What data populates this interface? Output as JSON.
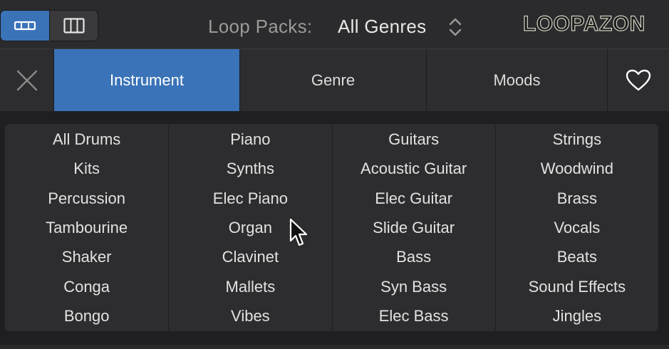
{
  "header": {
    "loop_packs_label": "Loop Packs:",
    "selected_pack": "All Genres",
    "brand": "LOOPAZON"
  },
  "view_toggle": {
    "selected": "button-view",
    "options": [
      "button-view",
      "column-view"
    ]
  },
  "tabs": [
    {
      "label": "Instrument",
      "active": true
    },
    {
      "label": "Genre",
      "active": false
    },
    {
      "label": "Moods",
      "active": false
    }
  ],
  "icons": {
    "close": "close-icon",
    "favorites": "heart-icon",
    "pack_selector": "chevron-up-down-icon"
  },
  "colors": {
    "accent": "#3a73b8",
    "background": "#1e1e20",
    "cell": "#2d2d2f",
    "text": "#e2e2e2"
  },
  "keywords": [
    [
      "All Drums",
      "Kits",
      "Percussion",
      "Tambourine",
      "Shaker",
      "Conga",
      "Bongo"
    ],
    [
      "Piano",
      "Synths",
      "Elec Piano",
      "Organ",
      "Clavinet",
      "Mallets",
      "Vibes"
    ],
    [
      "Guitars",
      "Acoustic Guitar",
      "Elec Guitar",
      "Slide Guitar",
      "Bass",
      "Syn Bass",
      "Elec Bass"
    ],
    [
      "Strings",
      "Woodwind",
      "Brass",
      "Vocals",
      "Beats",
      "Sound Effects",
      "Jingles"
    ]
  ]
}
